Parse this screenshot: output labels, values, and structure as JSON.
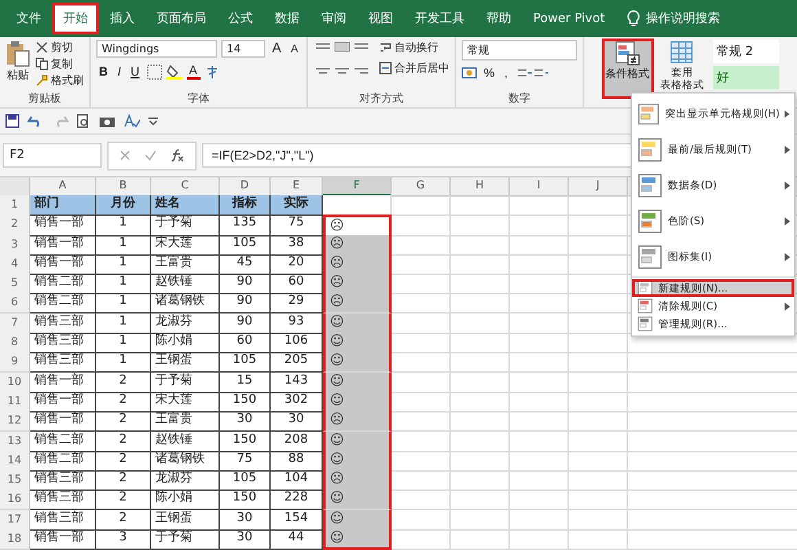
{
  "tabs": [
    {
      "label": "文件",
      "selected": false
    },
    {
      "label": "开始",
      "selected": true
    },
    {
      "label": "插入",
      "selected": false
    },
    {
      "label": "页面布局",
      "selected": false
    },
    {
      "label": "公式",
      "selected": false
    },
    {
      "label": "数据",
      "selected": false
    },
    {
      "label": "审阅",
      "selected": false
    },
    {
      "label": "视图",
      "selected": false
    },
    {
      "label": "开发工具",
      "selected": false
    },
    {
      "label": "帮助",
      "selected": false
    },
    {
      "label": "Power Pivot",
      "selected": false
    }
  ],
  "tell_me": "操作说明搜索",
  "ribbon": {
    "clipboard": {
      "paste": "粘贴",
      "cut": "剪切",
      "copy": "复制",
      "format_painter": "格式刷",
      "label": "剪贴板"
    },
    "font": {
      "name": "Wingdings",
      "size": "14",
      "grow": "A",
      "shrink": "A",
      "bold": "B",
      "italic": "I",
      "underline": "U",
      "color_letter": "A",
      "label": "字体"
    },
    "alignment": {
      "wrap": "自动换行",
      "merge": "合并后居中",
      "label": "对齐方式"
    },
    "number": {
      "format": "常规",
      "percent": "%",
      "comma": ",",
      "label": "数字"
    },
    "styles": {
      "conditional": "条件格式",
      "conditional_selected": true,
      "table_line_1": "套用",
      "table_line_2": "表格格式",
      "style_1": "常规 2",
      "style_2": "好"
    }
  },
  "formula_bar": {
    "name_box": "F2",
    "formula": "=IF(E2>D2,\"J\",\"L\")"
  },
  "sheet": {
    "columns": [
      {
        "label": "A",
        "selected": false
      },
      {
        "label": "B",
        "selected": false
      },
      {
        "label": "C",
        "selected": false
      },
      {
        "label": "D",
        "selected": false
      },
      {
        "label": "E",
        "selected": false
      },
      {
        "label": "F",
        "selected": true
      },
      {
        "label": "G",
        "selected": false
      },
      {
        "label": "H",
        "selected": false
      },
      {
        "label": "I",
        "selected": false
      },
      {
        "label": "J",
        "selected": false
      }
    ],
    "rows": [
      {
        "number": "1",
        "cells": [
          "部门",
          "月份",
          "姓名",
          "指标",
          "实际"
        ]
      },
      {
        "number": "2",
        "active": true,
        "cells": [
          "销售一部",
          "1",
          "于予菊",
          "135",
          "75",
          "☹"
        ]
      },
      {
        "number": "3",
        "active": false,
        "cells": [
          "销售一部",
          "1",
          "宋大莲",
          "105",
          "38",
          "☹"
        ]
      },
      {
        "number": "4",
        "active": false,
        "cells": [
          "销售一部",
          "1",
          "王富贵",
          "45",
          "20",
          "☹"
        ]
      },
      {
        "number": "5",
        "active": false,
        "cells": [
          "销售二部",
          "1",
          "赵铁锤",
          "90",
          "60",
          "☹"
        ]
      },
      {
        "number": "6",
        "active": false,
        "cells": [
          "销售二部",
          "1",
          "诸葛钢铁",
          "90",
          "29",
          "☹"
        ]
      },
      {
        "number": "7",
        "active": false,
        "cells": [
          "销售三部",
          "1",
          "龙淑芬",
          "90",
          "93",
          "☺"
        ]
      },
      {
        "number": "8",
        "active": false,
        "cells": [
          "销售三部",
          "1",
          "陈小娟",
          "60",
          "106",
          "☺"
        ]
      },
      {
        "number": "9",
        "active": false,
        "cells": [
          "销售三部",
          "1",
          "王钢蛋",
          "105",
          "205",
          "☺"
        ]
      },
      {
        "number": "10",
        "active": false,
        "cells": [
          "销售一部",
          "2",
          "于予菊",
          "15",
          "143",
          "☺"
        ]
      },
      {
        "number": "11",
        "active": false,
        "cells": [
          "销售一部",
          "2",
          "宋大莲",
          "150",
          "302",
          "☺"
        ]
      },
      {
        "number": "12",
        "active": false,
        "cells": [
          "销售一部",
          "2",
          "王富贵",
          "30",
          "30",
          "☹"
        ]
      },
      {
        "number": "13",
        "active": false,
        "cells": [
          "销售二部",
          "2",
          "赵铁锤",
          "150",
          "208",
          "☺"
        ]
      },
      {
        "number": "14",
        "active": false,
        "cells": [
          "销售二部",
          "2",
          "诸葛钢铁",
          "75",
          "88",
          "☺"
        ]
      },
      {
        "number": "15",
        "active": false,
        "cells": [
          "销售三部",
          "2",
          "龙淑芬",
          "105",
          "104",
          "☹"
        ]
      },
      {
        "number": "16",
        "active": false,
        "cells": [
          "销售三部",
          "2",
          "陈小娟",
          "150",
          "228",
          "☺"
        ]
      },
      {
        "number": "17",
        "active": false,
        "cells": [
          "销售三部",
          "2",
          "王钢蛋",
          "30",
          "154",
          "☺"
        ]
      },
      {
        "number": "18",
        "active": false,
        "cells": [
          "销售一部",
          "3",
          "于予菊",
          "30",
          "44",
          "☺"
        ]
      }
    ]
  },
  "menu": {
    "items": [
      {
        "label": "突出显示单元格规则(H)",
        "kind": "submenu",
        "selected": false
      },
      {
        "label": "最前/最后规则(T)",
        "kind": "submenu",
        "selected": false
      },
      {
        "label": "数据条(D)",
        "kind": "submenu",
        "selected": false
      },
      {
        "label": "色阶(S)",
        "kind": "submenu",
        "selected": false
      },
      {
        "label": "图标集(I)",
        "kind": "submenu",
        "selected": false
      },
      {
        "label": "新建规则(N)...",
        "kind": "command",
        "selected": true
      },
      {
        "label": "清除规则(C)",
        "kind": "submenu",
        "selected": false
      },
      {
        "label": "管理规则(R)...",
        "kind": "command",
        "selected": false
      }
    ]
  }
}
